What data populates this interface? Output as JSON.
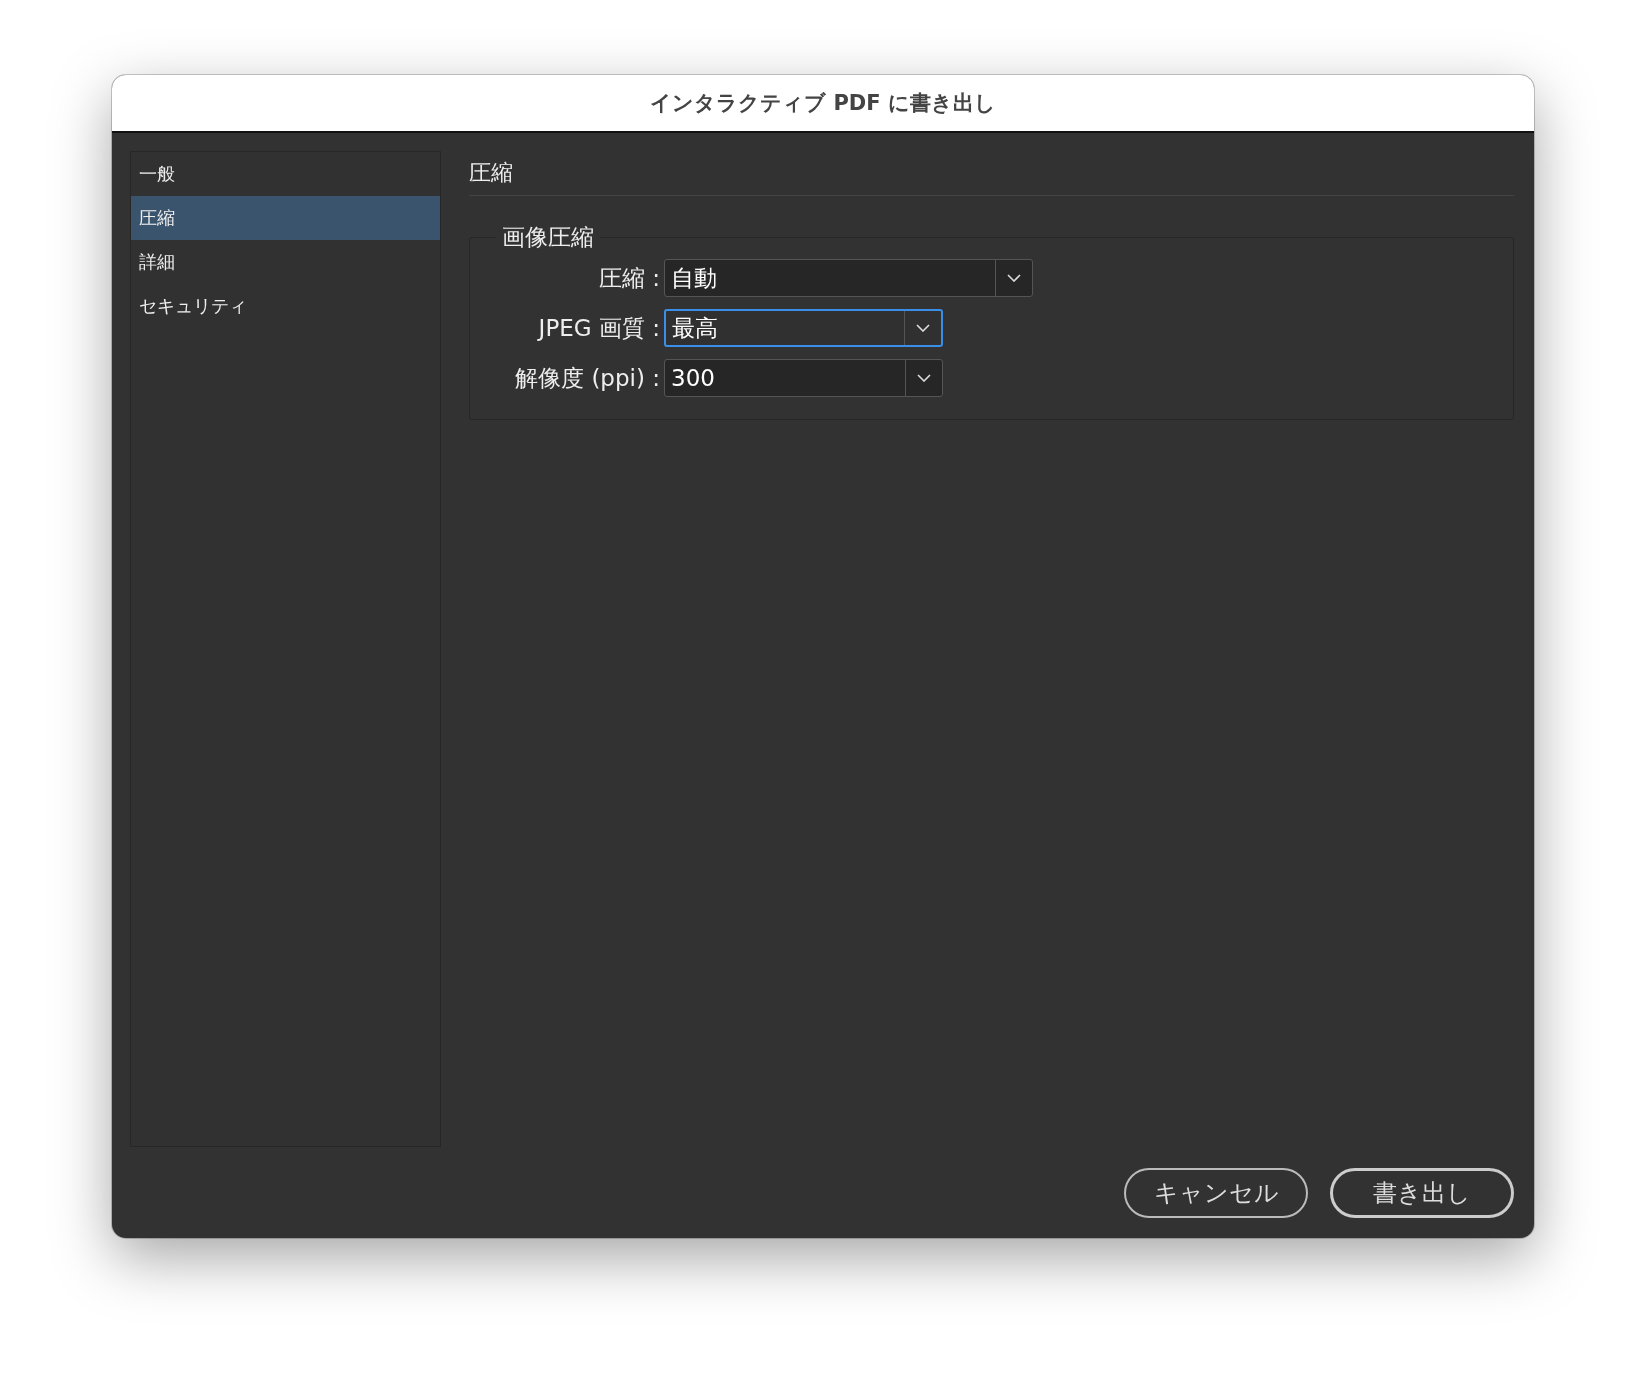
{
  "window": {
    "title": "インタラクティブ PDF に書き出し"
  },
  "sidebar": {
    "items": [
      {
        "label": "一般",
        "selected": false
      },
      {
        "label": "圧縮",
        "selected": true
      },
      {
        "label": "詳細",
        "selected": false
      },
      {
        "label": "セキュリティ",
        "selected": false
      }
    ]
  },
  "section": {
    "title": "圧縮"
  },
  "group": {
    "title": "画像圧縮",
    "fields": [
      {
        "label": "圧縮 :",
        "value": "自動",
        "focused": false,
        "kind": "wide"
      },
      {
        "label": "JPEG 画質 :",
        "value": "最高",
        "focused": true,
        "kind": "narrow"
      },
      {
        "label": "解像度 (ppi) :",
        "value": "300",
        "focused": false,
        "kind": "narrow"
      }
    ]
  },
  "buttons": [
    {
      "label": "キャンセル",
      "default": false
    },
    {
      "label": "書き出し",
      "default": true
    }
  ]
}
